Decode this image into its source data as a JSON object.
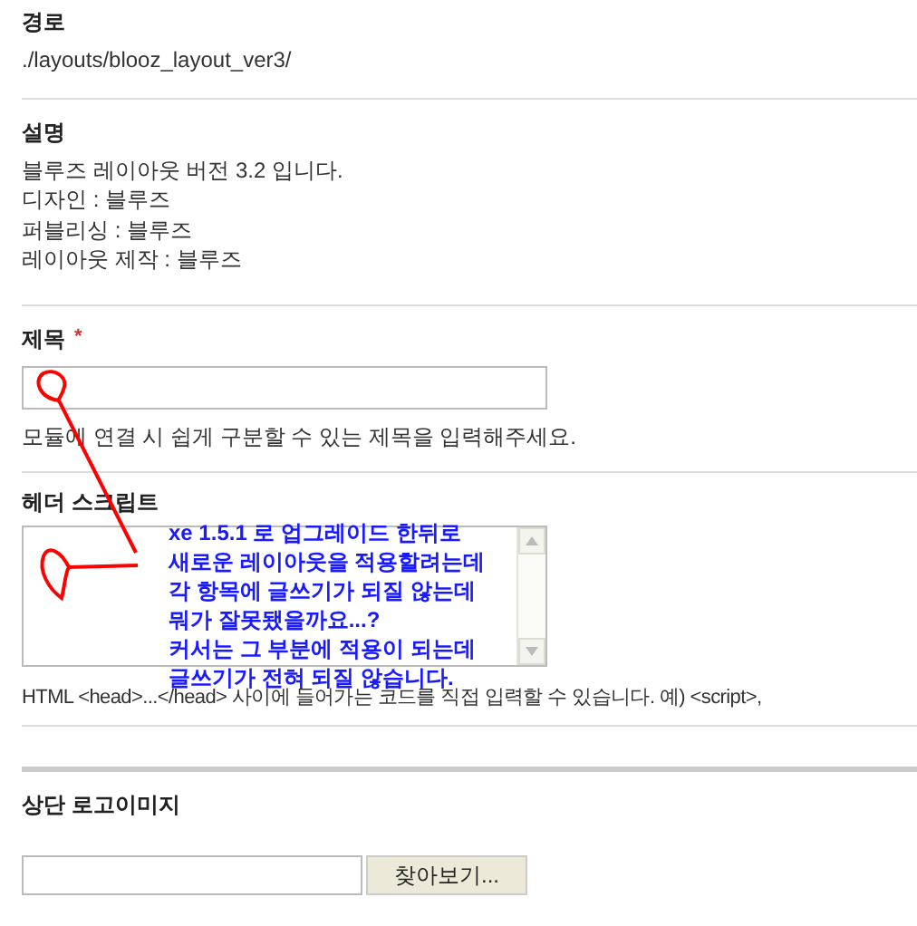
{
  "sections": [
    {
      "kind": "text",
      "label": "경로",
      "lines": [
        "./layouts/blooz_layout_ver3/"
      ]
    },
    {
      "kind": "text",
      "label": "설명",
      "lines": [
        "블루즈 레이아웃 버전 3.2 입니다.",
        "디자인 : 블루즈",
        "퍼블리싱 : 블루즈",
        "레이아웃 제작 : 블루즈"
      ]
    },
    {
      "kind": "input",
      "label": "제목",
      "required_mark": "*",
      "help": "모듈에 연결 시 쉽게 구분할 수 있는 제목을 입력해주세요."
    },
    {
      "kind": "textarea",
      "label": "헤더 스크립트",
      "help": "HTML <head>...</head> 사이에 들어가는 코드를 직접 입력할 수 있습니다. 예) <script>,"
    },
    {
      "kind": "file",
      "label": "상단 로고이미지",
      "button": "찾아보기..."
    }
  ],
  "annotation": {
    "lines": [
      "xe 1.5.1 로 업그레이드 한뒤로",
      "새로운 레이아웃을 적용할려는데",
      "각 항목에 글쓰기가 되질 않는데",
      "뭐가 잘못됐을까요...?",
      "커서는 그 부분에 적용이 되는데",
      "글쓰기가 전혀 되질 않습니다."
    ]
  }
}
